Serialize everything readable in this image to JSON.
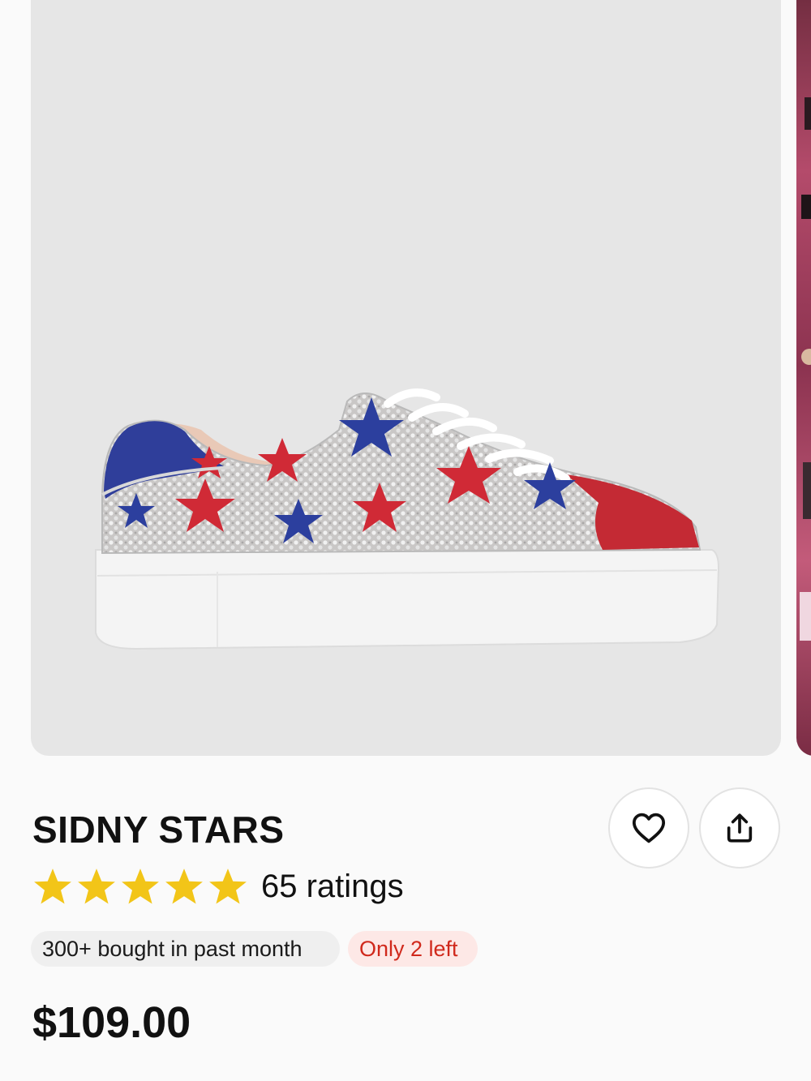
{
  "product": {
    "title": "SIDNY STARS",
    "rating": {
      "stars": 5,
      "max": 5,
      "count_label": "65 ratings"
    },
    "badges": {
      "bought": "300+ bought in past month",
      "stock": "Only 2 left"
    },
    "price": "$109.00"
  },
  "actions": {
    "wishlist_icon": "heart-icon",
    "share_icon": "share-icon"
  },
  "colors": {
    "star": "#f2c518",
    "stock_text": "#d0291c",
    "stock_bg": "#fde8e6",
    "badge_bg": "#efefef",
    "image_bg": "#e6e6e6"
  }
}
